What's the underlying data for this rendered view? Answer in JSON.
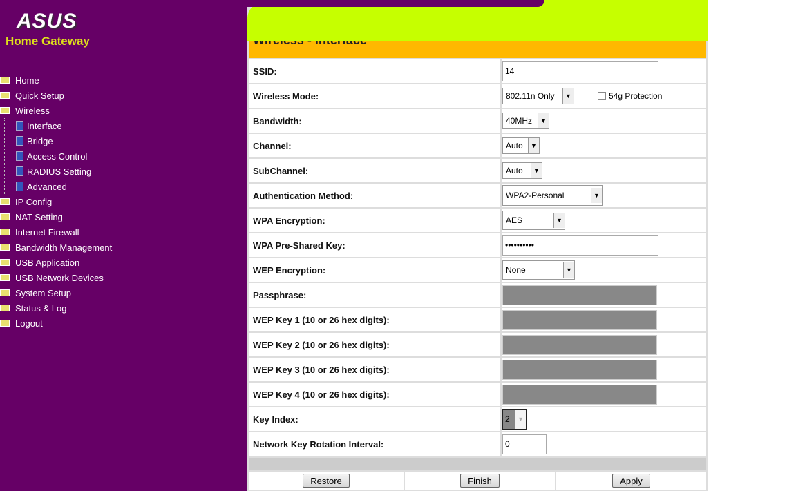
{
  "brand": {
    "logo": "ASUS",
    "subtitle": "Home Gateway"
  },
  "nav": {
    "items": [
      "Home",
      "Quick Setup",
      "Wireless"
    ],
    "wireless_sub": [
      "Interface",
      "Bridge",
      "Access Control",
      "RADIUS Setting",
      "Advanced"
    ],
    "items2": [
      "IP Config",
      "NAT Setting",
      "Internet Firewall",
      "Bandwidth Management",
      "USB Application",
      "USB Network Devices",
      "System Setup",
      "Status & Log",
      "Logout"
    ]
  },
  "page": {
    "title": "Wireless - Interface"
  },
  "form": {
    "ssid": {
      "label": "SSID:",
      "value": "14"
    },
    "mode": {
      "label": "Wireless Mode:",
      "value": "802.11n Only",
      "protection": "54g Protection"
    },
    "bandwidth": {
      "label": "Bandwidth:",
      "value": "40MHz"
    },
    "channel": {
      "label": "Channel:",
      "value": "Auto"
    },
    "subchannel": {
      "label": "SubChannel:",
      "value": "Auto"
    },
    "auth": {
      "label": "Authentication Method:",
      "value": "WPA2-Personal"
    },
    "wpaenc": {
      "label": "WPA Encryption:",
      "value": "AES"
    },
    "psk": {
      "label": "WPA Pre-Shared Key:",
      "value": "••••••••••"
    },
    "wepenc": {
      "label": "WEP Encryption:",
      "value": "None"
    },
    "passphrase": {
      "label": "Passphrase:"
    },
    "wep1": {
      "label": "WEP Key 1 (10 or 26 hex digits):"
    },
    "wep2": {
      "label": "WEP Key 2 (10 or 26 hex digits):"
    },
    "wep3": {
      "label": "WEP Key 3 (10 or 26 hex digits):"
    },
    "wep4": {
      "label": "WEP Key 4 (10 or 26 hex digits):"
    },
    "keyindex": {
      "label": "Key Index:",
      "value": "2"
    },
    "rotation": {
      "label": "Network Key Rotation Interval:",
      "value": "0"
    }
  },
  "buttons": {
    "restore": "Restore",
    "finish": "Finish",
    "apply": "Apply"
  }
}
